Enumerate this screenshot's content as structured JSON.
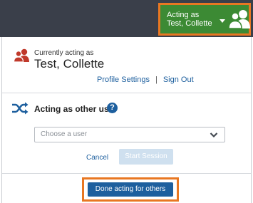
{
  "topbar": {
    "acting_button": {
      "line1": "Acting as",
      "line2": "Test, Collette",
      "caret_icon": "caret-down-icon",
      "people_icon": "users-icon"
    }
  },
  "current_user": {
    "icon": "users-icon",
    "label": "Currently acting as",
    "name": "Test, Collette",
    "profile_settings_link": "Profile Settings",
    "separator": "|",
    "sign_out_link": "Sign Out"
  },
  "act_as_other": {
    "icon": "shuffle-icon",
    "heading": "Acting as other user",
    "help_icon": "help-icon",
    "help_glyph": "?",
    "select": {
      "placeholder": "Choose a user",
      "chevron_icon": "chevron-down-icon"
    },
    "cancel_label": "Cancel",
    "start_label": "Start Session"
  },
  "footer": {
    "done_label": "Done acting for others"
  },
  "colors": {
    "topbar": "#3a3f4a",
    "acting_green": "#3c8a34",
    "highlight_orange": "#e87722",
    "link_blue": "#1d5f9e",
    "icon_red": "#c0392b",
    "disabled_button": "#cfe0ef"
  }
}
